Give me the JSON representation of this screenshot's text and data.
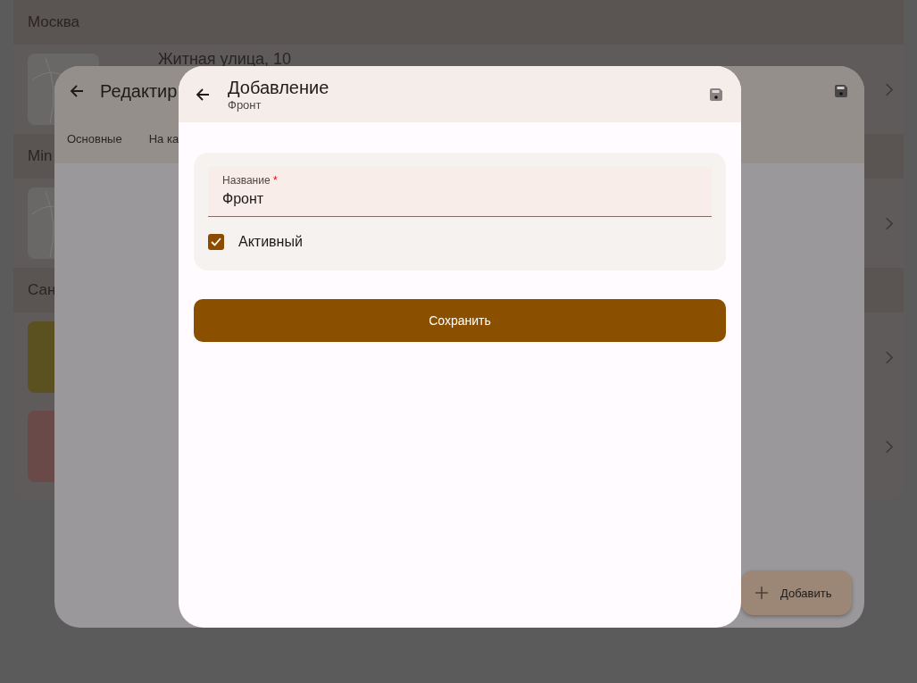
{
  "background": {
    "groups": [
      {
        "title": "Москва",
        "items": [
          {
            "kind": "map",
            "title": "Житная улица, 10"
          }
        ]
      },
      {
        "title": "Min",
        "items": [
          {
            "kind": "map"
          }
        ]
      },
      {
        "title": "Сан",
        "items": [
          {
            "kind": "photo",
            "color": "#5a5020"
          },
          {
            "kind": "photo",
            "color": "#6a4a48"
          }
        ]
      }
    ]
  },
  "editor": {
    "title": "Редактир",
    "tabs": [
      "Основные",
      "На ка"
    ],
    "fab": {
      "label": "Добавить"
    }
  },
  "dialog": {
    "title": "Добавление",
    "subtitle": "Фронт",
    "field": {
      "label": "Название",
      "required_mark": "*",
      "value": "Фронт"
    },
    "checkbox": {
      "label": "Активный",
      "checked": true
    },
    "button": "Сохранить"
  }
}
